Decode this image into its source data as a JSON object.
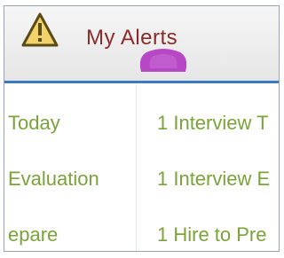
{
  "header": {
    "title": "My Alerts",
    "warning_icon": "warning-triangle-icon",
    "badge_icon": "notification-badge-icon"
  },
  "alerts": {
    "rows": [
      {
        "label": "Today",
        "value": "1 Interview T"
      },
      {
        "label": "Evaluation",
        "value": "1 Interview E"
      },
      {
        "label": "epare",
        "value": "1 Hire to Pre"
      }
    ]
  },
  "colors": {
    "accent_blue": "#3a78c8",
    "text_green": "#7aa33a",
    "title_color": "#8a2a2a",
    "badge_purple": "#b648c6"
  }
}
